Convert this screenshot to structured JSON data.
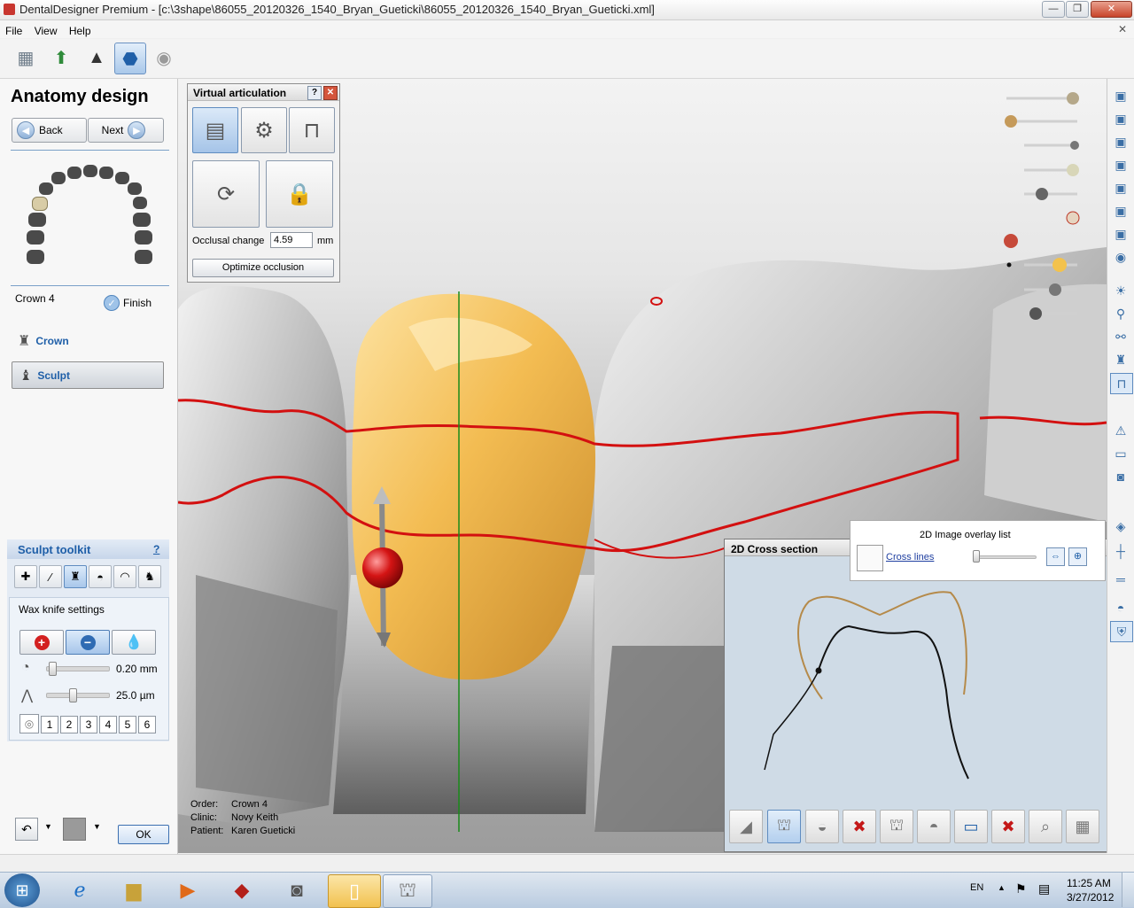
{
  "window": {
    "title": "DentalDesigner Premium - [c:\\3shape\\86055_20120326_1540_Bryan_Gueticki\\86055_20120326_1540_Bryan_Gueticki.xml]",
    "minimize": "—",
    "maximize": "❐",
    "close": "✕"
  },
  "menu": {
    "file": "File",
    "view": "View",
    "help": "Help"
  },
  "toolbar": {
    "icons": [
      "order-icon",
      "model-icon",
      "preparation-icon",
      "design-icon",
      "disc-icon"
    ]
  },
  "left": {
    "heading": "Anatomy design",
    "back": "Back",
    "next": "Next",
    "crown_label": "Crown 4",
    "finish": "Finish",
    "crown_step": "Crown",
    "sculpt_step": "Sculpt",
    "sculpt_toolkit": "Sculpt toolkit",
    "help_mark": "?",
    "wax_settings": "Wax knife settings",
    "size_value": "0.20 mm",
    "strength_value": "25.0 µm",
    "size_level": 0.05,
    "strength_level": 0.4,
    "numbers": [
      "1",
      "2",
      "3",
      "4",
      "5",
      "6"
    ],
    "ok": "OK"
  },
  "va": {
    "title": "Virtual articulation",
    "help": "?",
    "close": "✕",
    "occlusal_label": "Occlusal change",
    "occlusal_value": "4.59",
    "occlusal_unit": "mm",
    "optimize": "Optimize occlusion"
  },
  "info": {
    "order_label": "Order:",
    "order_value": "Crown 4",
    "clinic_label": "Clinic:",
    "clinic_value": "Novy Keith",
    "patient_label": "Patient:",
    "patient_value": "Karen Gueticki"
  },
  "cross": {
    "title": "2D Cross section",
    "overlay_title": "2D Image overlay list",
    "cross_lines": "Cross lines"
  },
  "taskbar": {
    "lang": "EN",
    "time": "11:25 AM",
    "date": "3/27/2012"
  },
  "colors": {
    "accent": "#1f5fa8",
    "crown": "#f0b84a",
    "margin": "#d31010",
    "taskbar": "#c8d6e6"
  }
}
